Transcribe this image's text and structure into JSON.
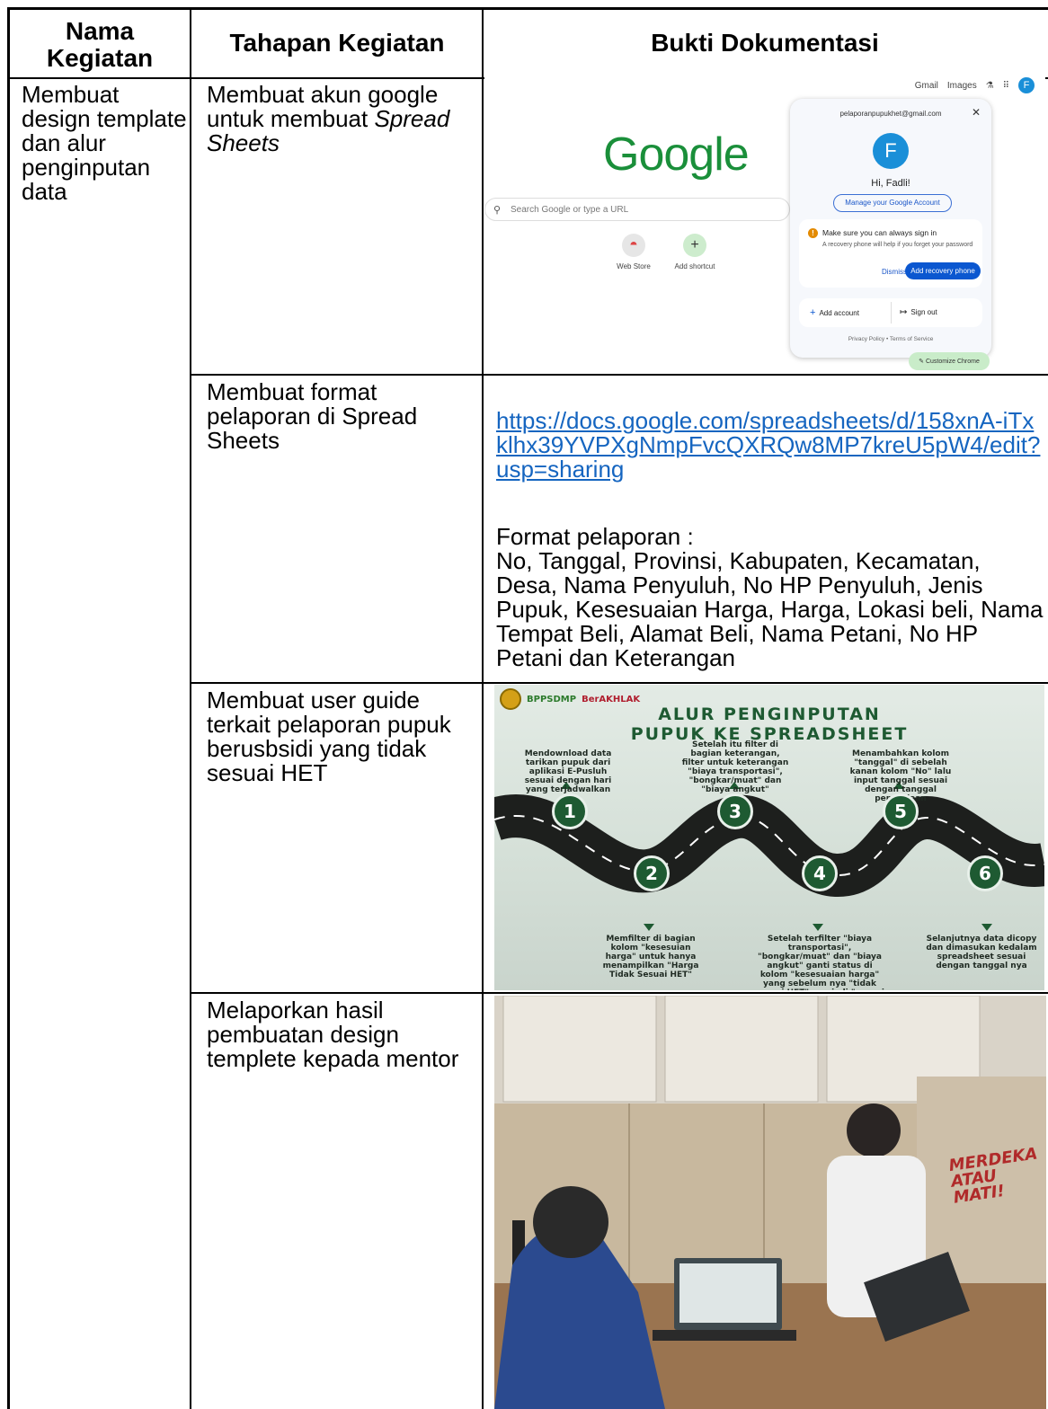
{
  "table": {
    "headers": {
      "nama_kegiatan": "Nama Kegiatan",
      "tahapan_kegiatan": "Tahapan Kegiatan",
      "bukti_dokumentasi": "Bukti Dokumentasi"
    },
    "nama_kegiatan": "Membuat design template dan alur penginputan data",
    "rows": [
      {
        "tahapan_line1": "Membuat akun google untuk membuat",
        "tahapan_italic": "Spread Sheets"
      },
      {
        "tahapan": "Membuat format pelaporan di Spread Sheets",
        "link": "https://docs.google.com/spreadsheets/d/158xnA-iTxklhx39YVPXgNmpFvcQXRQw8MP7kreU5pW4/edit?usp=sharing",
        "format_label": "Format pelaporan :",
        "format_fields": "No, Tanggal, Provinsi, Kabupaten, Kecamatan, Desa, Nama Penyuluh, No HP Penyuluh, Jenis Pupuk, Kesesuaian Harga, Harga, Lokasi beli, Nama Tempat Beli, Alamat Beli, Nama Petani, No HP Petani dan Keterangan"
      },
      {
        "tahapan": "Membuat user guide terkait pelaporan pupuk berusbsidi yang tidak sesuai HET"
      },
      {
        "tahapan": "Melaporkan hasil pembuatan design templete kepada mentor"
      }
    ]
  },
  "google_screenshot": {
    "top_links": [
      "Gmail",
      "Images"
    ],
    "avatar_letter": "F",
    "logo": "Google",
    "search_placeholder": "Search Google or type a URL",
    "shortcuts": [
      "Web Store",
      "Add shortcut"
    ],
    "account_email": "pelaporanpupukhet@gmail.com",
    "greeting": "Hi, Fadli!",
    "manage_button": "Manage your Google Account",
    "warning_title": "Make sure you can always sign in",
    "warning_text": "A recovery phone will help if you forget your password",
    "dismiss": "Dismiss",
    "add_recovery": "Add recovery phone",
    "add_account": "Add account",
    "sign_out": "Sign out",
    "privacy": "Privacy Policy  •  Terms of Service",
    "customize": "Customize Chrome"
  },
  "infographic": {
    "logo_text_1": "BPPSDMP",
    "logo_text_2": "BerAKHLAK",
    "title_line1": "ALUR PENGINPUTAN",
    "title_line2": "PUPUK KE SPREADSHEET",
    "steps": [
      {
        "num": "1",
        "text": "Mendownload data tarikan pupuk dari aplikasi E-Pusluh sesuai dengan hari yang terjadwalkan"
      },
      {
        "num": "2",
        "text": "Memfilter di bagian kolom \"kesesuian harga\" untuk hanya menampilkan \"Harga Tidak Sesuai HET\""
      },
      {
        "num": "3",
        "text": "Setelah itu filter di bagian keterangan, filter untuk keterangan \"biaya transportasi\", \"bongkar/muat\" dan \"biaya angkut\""
      },
      {
        "num": "4",
        "text": "Setelah terfilter \"biaya transportasi\", \"bongkar/muat\" dan \"biaya angkut\" ganti status di kolom \"kesesuaian harga\" yang sebelum nya \"tidak sesuai HET\" menjadi \"sesuai HET\""
      },
      {
        "num": "5",
        "text": "Menambahkan kolom \"tanggal\" di sebelah kanan kolom \"No\" lalu input tanggal sesuai dengan tanggal pengerjaan"
      },
      {
        "num": "6",
        "text": "Selanjutnya data dicopy dan dimasukan kedalam spreadsheet sesuai dengan tanggal nya"
      }
    ]
  },
  "photo": {
    "wall_text": "MERDEKA ATAU MATI!"
  }
}
